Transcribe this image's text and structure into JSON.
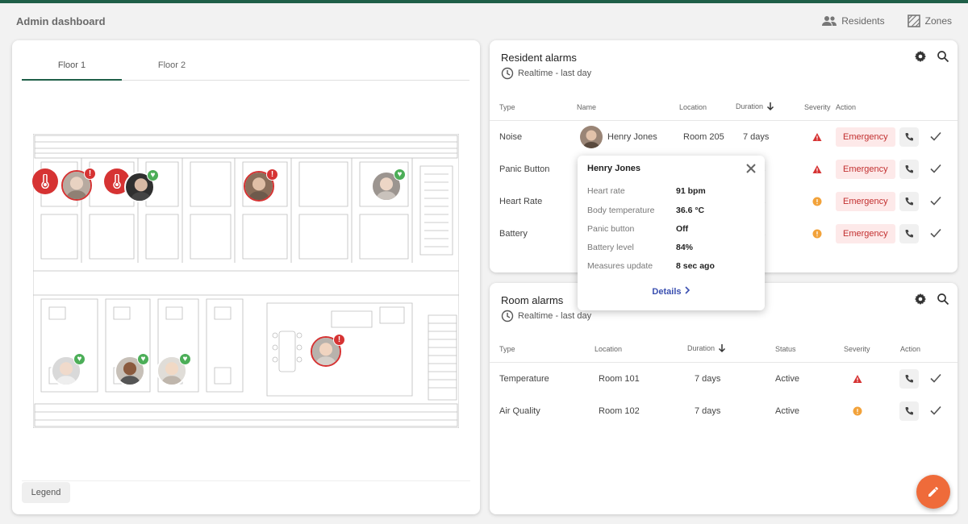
{
  "header": {
    "title": "Admin dashboard",
    "links": [
      {
        "label": "Residents",
        "icon": "people-icon"
      },
      {
        "label": "Zones",
        "icon": "zones-icon"
      }
    ]
  },
  "map": {
    "tabs": [
      {
        "label": "Floor 1"
      },
      {
        "label": "Floor 2"
      }
    ],
    "active_tab": "Floor 1",
    "legend_label": "Legend"
  },
  "resident_alarms": {
    "title": "Resident alarms",
    "subtitle": "Realtime - last day",
    "columns": {
      "type": "Type",
      "name": "Name",
      "location": "Location",
      "duration": "Duration",
      "severity": "Severity",
      "action": "Action"
    },
    "rows": [
      {
        "type": "Noise",
        "name": "Henry Jones",
        "location": "Room 205",
        "duration": "7 days",
        "severity": "high",
        "action": "Emergency"
      },
      {
        "type": "Panic Button",
        "name": "",
        "location": "",
        "duration": "s",
        "severity": "high",
        "action": "Emergency"
      },
      {
        "type": "Heart Rate",
        "name": "",
        "location": "",
        "duration": "s",
        "severity": "medium",
        "action": "Emergency"
      },
      {
        "type": "Battery",
        "name": "",
        "location": "",
        "duration": "s",
        "severity": "medium",
        "action": "Emergency"
      }
    ]
  },
  "popup": {
    "name": "Henry Jones",
    "rows": [
      {
        "label": "Heart rate",
        "value": "91 bpm"
      },
      {
        "label": "Body temperature",
        "value": "36.6 °C"
      },
      {
        "label": "Panic button",
        "value": "Off"
      },
      {
        "label": "Battery level",
        "value": "84%"
      },
      {
        "label": "Measures update",
        "value": "8 sec ago"
      }
    ],
    "details_label": "Details"
  },
  "room_alarms": {
    "title": "Room alarms",
    "subtitle": "Realtime - last day",
    "columns": {
      "type": "Type",
      "location": "Location",
      "duration": "Duration",
      "status": "Status",
      "severity": "Severity",
      "action": "Action"
    },
    "rows": [
      {
        "type": "Temperature",
        "location": "Room 101",
        "duration": "7 days",
        "status": "Active",
        "severity": "high"
      },
      {
        "type": "Air Quality",
        "location": "Room 102",
        "duration": "7 days",
        "status": "Active",
        "severity": "medium"
      }
    ]
  },
  "colors": {
    "brand": "#1f5f48",
    "alert_red": "#d63333",
    "ok_green": "#4cae58",
    "warning_orange": "#f2a23a",
    "fab": "#ef6b3a"
  }
}
